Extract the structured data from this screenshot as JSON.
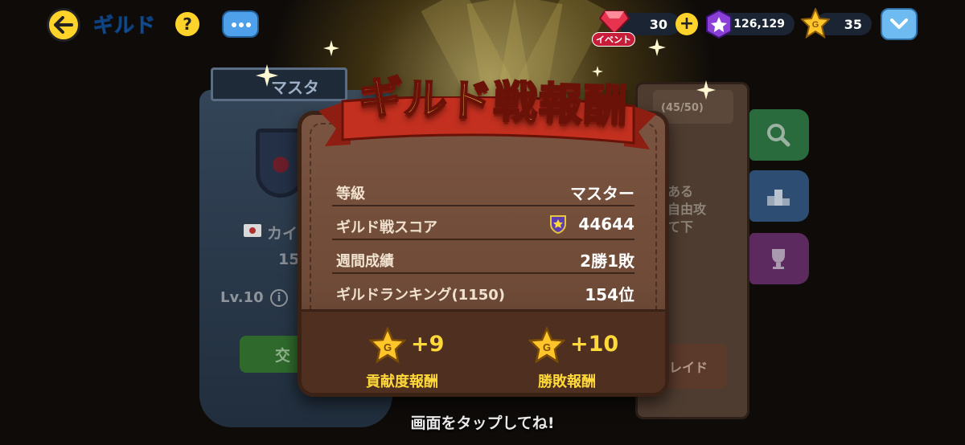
{
  "header": {
    "title": "ギルド",
    "help_label": "?"
  },
  "currency": {
    "gems": {
      "value": "30",
      "badge": "イベント"
    },
    "crystals": {
      "value": "126,129"
    },
    "gold_stars": {
      "value": "35"
    },
    "add_label": "+"
  },
  "background": {
    "guild_rank_ribbon": "マスタ",
    "guild_name_partial": "カイ",
    "guild_score_partial": "15",
    "level_label": "Lv.10",
    "member_count": "(45/50)",
    "panel_text_lines": [
      "ある",
      "自由攻",
      "て下"
    ],
    "join_button_partial": "交",
    "trade_button_partial": "レイド"
  },
  "modal": {
    "title": "ギルド戦報酬",
    "rows": [
      {
        "label": "等級",
        "value": "マスター"
      },
      {
        "label": "ギルド戦スコア",
        "value": "44644"
      },
      {
        "label": "週間成績",
        "value": "2勝1敗"
      },
      {
        "label": "ギルドランキング(1150)",
        "value": "154位"
      }
    ],
    "rewards": [
      {
        "amount": "+9",
        "label": "貢献度報酬"
      },
      {
        "amount": "+10",
        "label": "勝敗報酬"
      }
    ]
  },
  "tap_hint": "画面をタップしてね!",
  "colors": {
    "accent_yellow": "#ffd32a",
    "title_blue": "#4ea3ff",
    "modal_brown": "#6f4b38",
    "reward_gold": "#ffd83a"
  }
}
